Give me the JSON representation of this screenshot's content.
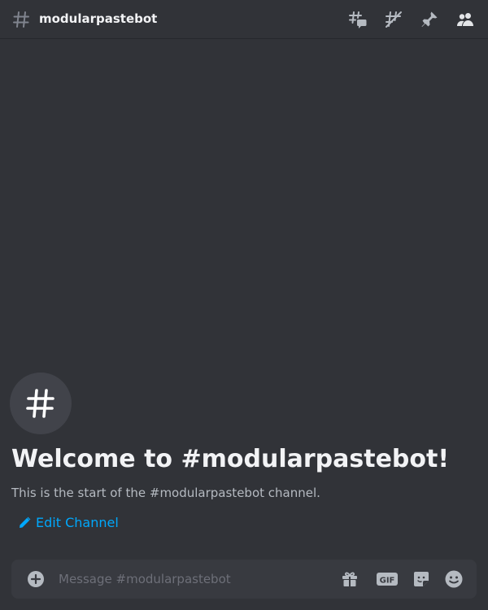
{
  "header": {
    "channel_name": "modularpastebot",
    "icons": [
      "hashtag-icon",
      "threads-icon",
      "notification-muted-icon",
      "pin-icon",
      "member-list-icon"
    ]
  },
  "welcome": {
    "title": "Welcome to #modularpastebot!",
    "subtitle": "This is the start of the #modularpastebot channel.",
    "edit_label": "Edit Channel"
  },
  "composer": {
    "placeholder": "Message #modularpastebot",
    "gif_label": "GIF",
    "icons": [
      "attach-plus-icon",
      "gift-icon",
      "gif-icon",
      "sticker-icon",
      "emoji-icon"
    ]
  },
  "colors": {
    "background": "#313338",
    "input_background": "#383a40",
    "link": "#00a8fc",
    "text_primary": "#f2f3f5",
    "text_muted": "#b5bac1",
    "icon": "#b5bac1"
  }
}
